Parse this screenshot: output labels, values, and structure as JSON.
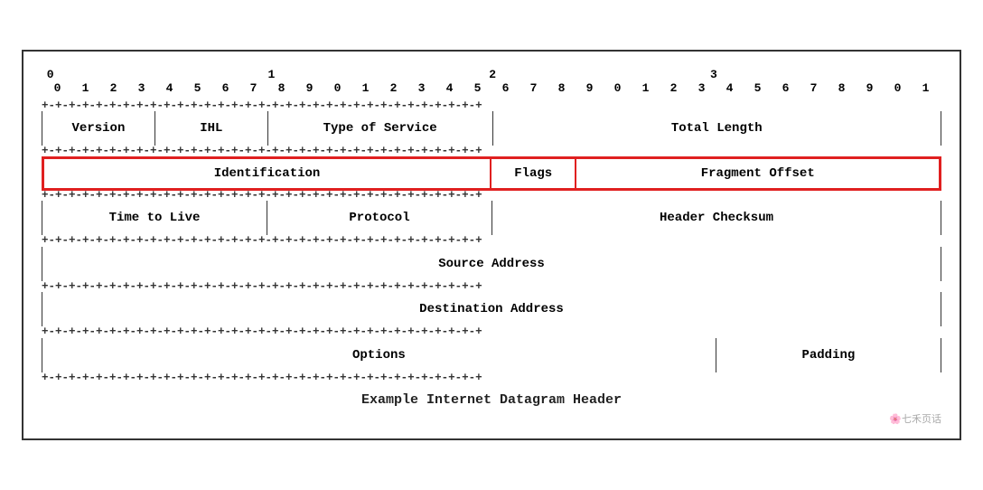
{
  "title": "Example Internet Datagram Header",
  "watermark": "🌸七禾页话",
  "bit_row_majors": [
    "0",
    "",
    "",
    "",
    "",
    "",
    "",
    "",
    "",
    "",
    "",
    "",
    "",
    "",
    "",
    "",
    "1",
    "",
    "",
    "",
    "",
    "",
    "",
    "",
    "",
    "",
    "",
    "",
    "",
    "",
    "",
    "",
    "2",
    "",
    "",
    "",
    "",
    "",
    "",
    "",
    "",
    "",
    "",
    "",
    "",
    "",
    "",
    "",
    "3"
  ],
  "bit_row_minors": [
    "0",
    "1",
    "2",
    "3",
    "4",
    "5",
    "6",
    "7",
    "8",
    "9",
    "0",
    "1",
    "2",
    "3",
    "4",
    "5",
    "6",
    "7",
    "8",
    "9",
    "0",
    "1",
    "2",
    "3",
    "4",
    "5",
    "6",
    "7",
    "8",
    "9",
    "0",
    "1"
  ],
  "separator": "+-+--+-+-+-+-+-+-+-+-+-+-+-+-+-+-+-+-+-+-+-+-+-+-+-+-+-+-+-+-+-+-+-+-+-+-+-+-+-+-+-+-+-+-+-+-+-+-+-+-+-+-+-+-+-+-+-+-+-+-+-+-+",
  "rows": [
    {
      "highlighted": false,
      "cells": [
        {
          "label": "Version",
          "bits": 4
        },
        {
          "label": "IHL",
          "bits": 4
        },
        {
          "label": "Type of Service",
          "bits": 8
        },
        {
          "label": "Total Length",
          "bits": 16
        }
      ]
    },
    {
      "highlighted": true,
      "cells": [
        {
          "label": "Identification",
          "bits": 16
        },
        {
          "label": "Flags",
          "bits": 3
        },
        {
          "label": "Fragment Offset",
          "bits": 13
        }
      ]
    },
    {
      "highlighted": false,
      "cells": [
        {
          "label": "Time to Live",
          "bits": 8
        },
        {
          "label": "Protocol",
          "bits": 8
        },
        {
          "label": "Header Checksum",
          "bits": 16
        }
      ]
    },
    {
      "highlighted": false,
      "cells": [
        {
          "label": "Source Address",
          "bits": 32
        }
      ]
    },
    {
      "highlighted": false,
      "cells": [
        {
          "label": "Destination Address",
          "bits": 32
        }
      ]
    },
    {
      "highlighted": false,
      "cells": [
        {
          "label": "Options",
          "bits": 24
        },
        {
          "label": "Padding",
          "bits": 8
        }
      ]
    }
  ],
  "caption": "Example Internet Datagram Header"
}
